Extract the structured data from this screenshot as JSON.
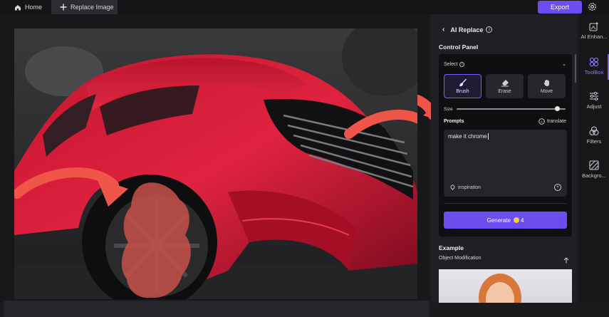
{
  "topbar": {
    "home_label": "Home",
    "replace_tab_label": "Replace Image",
    "export_label": "Export"
  },
  "panel": {
    "title": "AI Replace",
    "control_panel_title": "Control Panel",
    "select_label": "Select",
    "tools": [
      {
        "label": "Brush",
        "icon": "brush-icon",
        "active": true
      },
      {
        "label": "Erase",
        "icon": "eraser-icon",
        "active": false
      },
      {
        "label": "Move",
        "icon": "hand-icon",
        "active": false
      }
    ],
    "size_label": "Size",
    "size_value": 0.92,
    "prompts_label": "Prompts",
    "translate_label": "translate",
    "prompt_value": "make it chrome",
    "inspiration_label": "inspiration",
    "generate_label": "Generate",
    "generate_cost": "4",
    "example_title": "Example",
    "example_subtitle": "Object Modification"
  },
  "rail": {
    "items": [
      {
        "label": "AI Enhan...",
        "icon": "ai-enhance-icon"
      },
      {
        "label": "ToolBox",
        "icon": "toolbox-icon"
      },
      {
        "label": "Adjust",
        "icon": "adjust-icon"
      },
      {
        "label": "Filters",
        "icon": "filters-icon"
      },
      {
        "label": "Backgro...",
        "icon": "background-icon"
      }
    ],
    "active": "ToolBox"
  },
  "colors": {
    "accent": "#6b4df0",
    "car_red": "#d6223c",
    "mask_red": "#c7504a",
    "arrow": "#f0554a"
  }
}
